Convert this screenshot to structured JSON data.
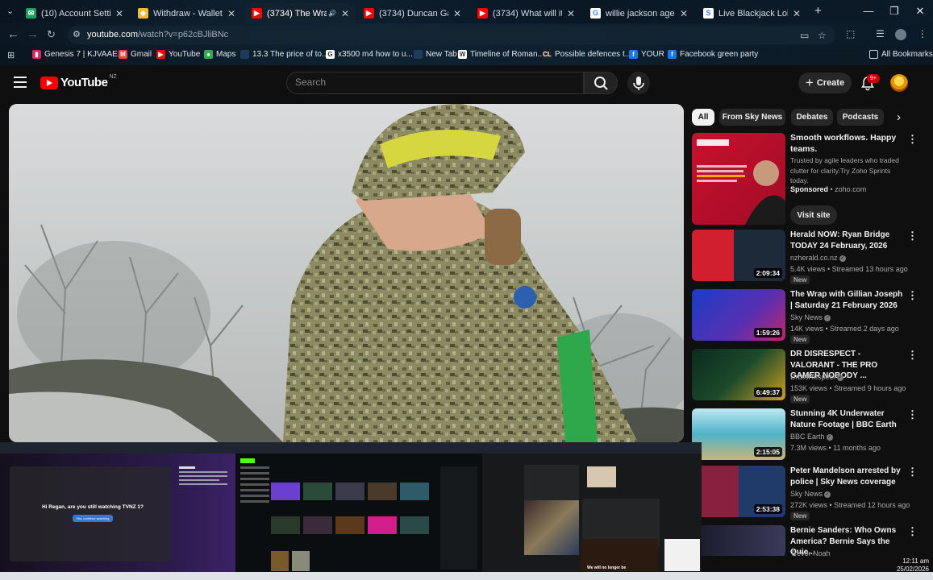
{
  "browser": {
    "tabs": [
      {
        "title": "(10) Account Settings / S",
        "color": "#1aa260",
        "glyph": "✉"
      },
      {
        "title": "Withdraw - Wallets - Bin",
        "color": "#f3ba2f",
        "glyph": "◆"
      },
      {
        "title": "(3734) The Wrap wi",
        "color": "#ff0000",
        "glyph": "▶",
        "active": true
      },
      {
        "title": "(3734) Duncan Garner",
        "color": "#ff0000",
        "glyph": "▶"
      },
      {
        "title": "(3734) What will it take I",
        "color": "#ff0000",
        "glyph": "▶"
      },
      {
        "title": "willie jackson age - Goog",
        "color": "#ffffff",
        "glyph": "G"
      },
      {
        "title": "Live Blackjack Lobby - Pl",
        "color": "#ffffff",
        "glyph": "S"
      }
    ],
    "url": {
      "domain": "youtube.com",
      "path": "/watch?v=p62cBJliBNc"
    },
    "bookmarks": [
      {
        "label": "Genesis 7 | KJVAAE...",
        "color": "#e0245e",
        "glyph": "▮"
      },
      {
        "label": "Gmail",
        "color": "#ea4335",
        "glyph": "M"
      },
      {
        "label": "YouTube",
        "color": "#ff0000",
        "glyph": "▶"
      },
      {
        "label": "Maps",
        "color": "#34a853",
        "glyph": "●"
      },
      {
        "label": "13.3 The price of to...",
        "color": "#1f3b5a",
        "glyph": ""
      },
      {
        "label": "x3500 m4 how to u...",
        "color": "#ffffff",
        "glyph": "G"
      },
      {
        "label": "New Tab",
        "color": "#1f3b5a",
        "glyph": ""
      },
      {
        "label": "Timeline of Roman...",
        "color": "#ffffff",
        "glyph": "W"
      },
      {
        "label": "Possible defences t...",
        "color": "#222222",
        "glyph": "CL"
      },
      {
        "label": "YOUR",
        "color": "#1877f2",
        "glyph": "f"
      },
      {
        "label": "Facebook green party",
        "color": "#1877f2",
        "glyph": "f"
      }
    ],
    "all_bookmarks": "All Bookmarks"
  },
  "youtube": {
    "logo_text": "YouTube",
    "country": "NZ",
    "search_placeholder": "Search",
    "create_label": "Create",
    "notif_count": "9+",
    "chips": [
      "All",
      "From Sky News",
      "Debates",
      "Podcasts"
    ],
    "ad": {
      "title": "Smooth workflows. Happy teams.",
      "description": "Trusted by agile leaders who traded clutter for clarity.Try Zoho Sprints today.",
      "sponsored": "Sponsored",
      "domain": "zoho.com",
      "cta": "Visit site"
    },
    "recommendations": [
      {
        "title": "Herald NOW: Ryan Bridge TODAY 24 February, 2026",
        "channel": "nzherald.co.nz",
        "meta": "5.4K views • Streamed 13 hours ago",
        "duration": "2:09:34",
        "new": "New"
      },
      {
        "title": "The Wrap with Gillian Joseph | Saturday 21 February 2026",
        "channel": "Sky News",
        "meta": "14K views • Streamed 2 days ago",
        "duration": "1:59:26",
        "new": "New"
      },
      {
        "title": "DR DISRESPECT - VALORANT - THE PRO GAMER NOBODY ...",
        "channel": "DrDisRespect",
        "meta": "153K views • Streamed 9 hours ago",
        "duration": "6:49:37",
        "new": "New"
      },
      {
        "title": "Stunning 4K Underwater Nature Footage | BBC Earth",
        "channel": "BBC Earth",
        "meta": "7.3M views • 11 months ago",
        "duration": "2:15:05",
        "new": ""
      },
      {
        "title": "Peter Mandelson arrested by police | Sky News coverage",
        "channel": "Sky News",
        "meta": "272K views • Streamed 12 hours ago",
        "duration": "2:53:38",
        "new": "New"
      },
      {
        "title": "Bernie Sanders: Who Owns America? Bernie Says the Quie...",
        "channel": "Trevor Noah",
        "meta": "",
        "duration": "",
        "new": ""
      }
    ]
  },
  "previews": {
    "p1_text": "Hi Regan, are you still watching TVNZ 1?",
    "p1_button": "Yes, continue watching",
    "p3_text": "We will no longer be"
  },
  "clock": {
    "time": "12:11 am",
    "date": "25/02/2026"
  }
}
